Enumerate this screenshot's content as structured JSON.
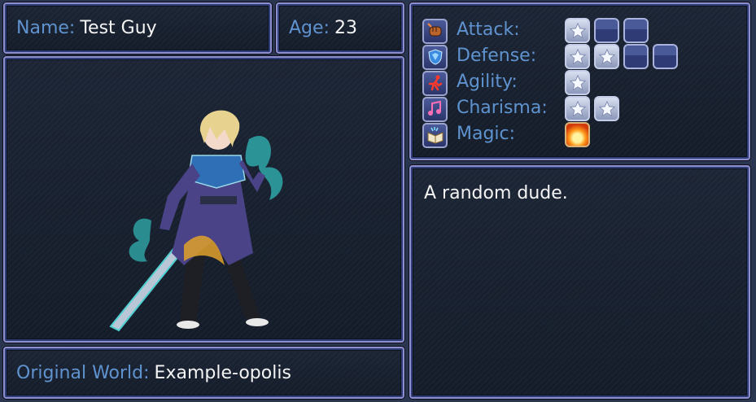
{
  "name": {
    "label": "Name:",
    "value": "Test Guy"
  },
  "age": {
    "label": "Age:",
    "value": "23"
  },
  "world": {
    "label": "Original World:",
    "value": "Example-opolis"
  },
  "description": "A random dude.",
  "stats": [
    {
      "label": "Attack:",
      "icon": "fist-icon",
      "filled": 1,
      "max": 3,
      "kind": "star"
    },
    {
      "label": "Defense:",
      "icon": "shield-icon",
      "filled": 2,
      "max": 4,
      "kind": "star"
    },
    {
      "label": "Agility:",
      "icon": "running-icon",
      "filled": 1,
      "max": 1,
      "kind": "star"
    },
    {
      "label": "Charisma:",
      "icon": "music-note-icon",
      "filled": 2,
      "max": 2,
      "kind": "star"
    },
    {
      "label": "Magic:",
      "icon": "spellbook-icon",
      "filled": 1,
      "max": 1,
      "kind": "fire"
    }
  ],
  "colors": {
    "label": "#5f93cf",
    "value": "#f4f4f4",
    "border": "#8f8fd0",
    "panel": "#1a2232"
  }
}
